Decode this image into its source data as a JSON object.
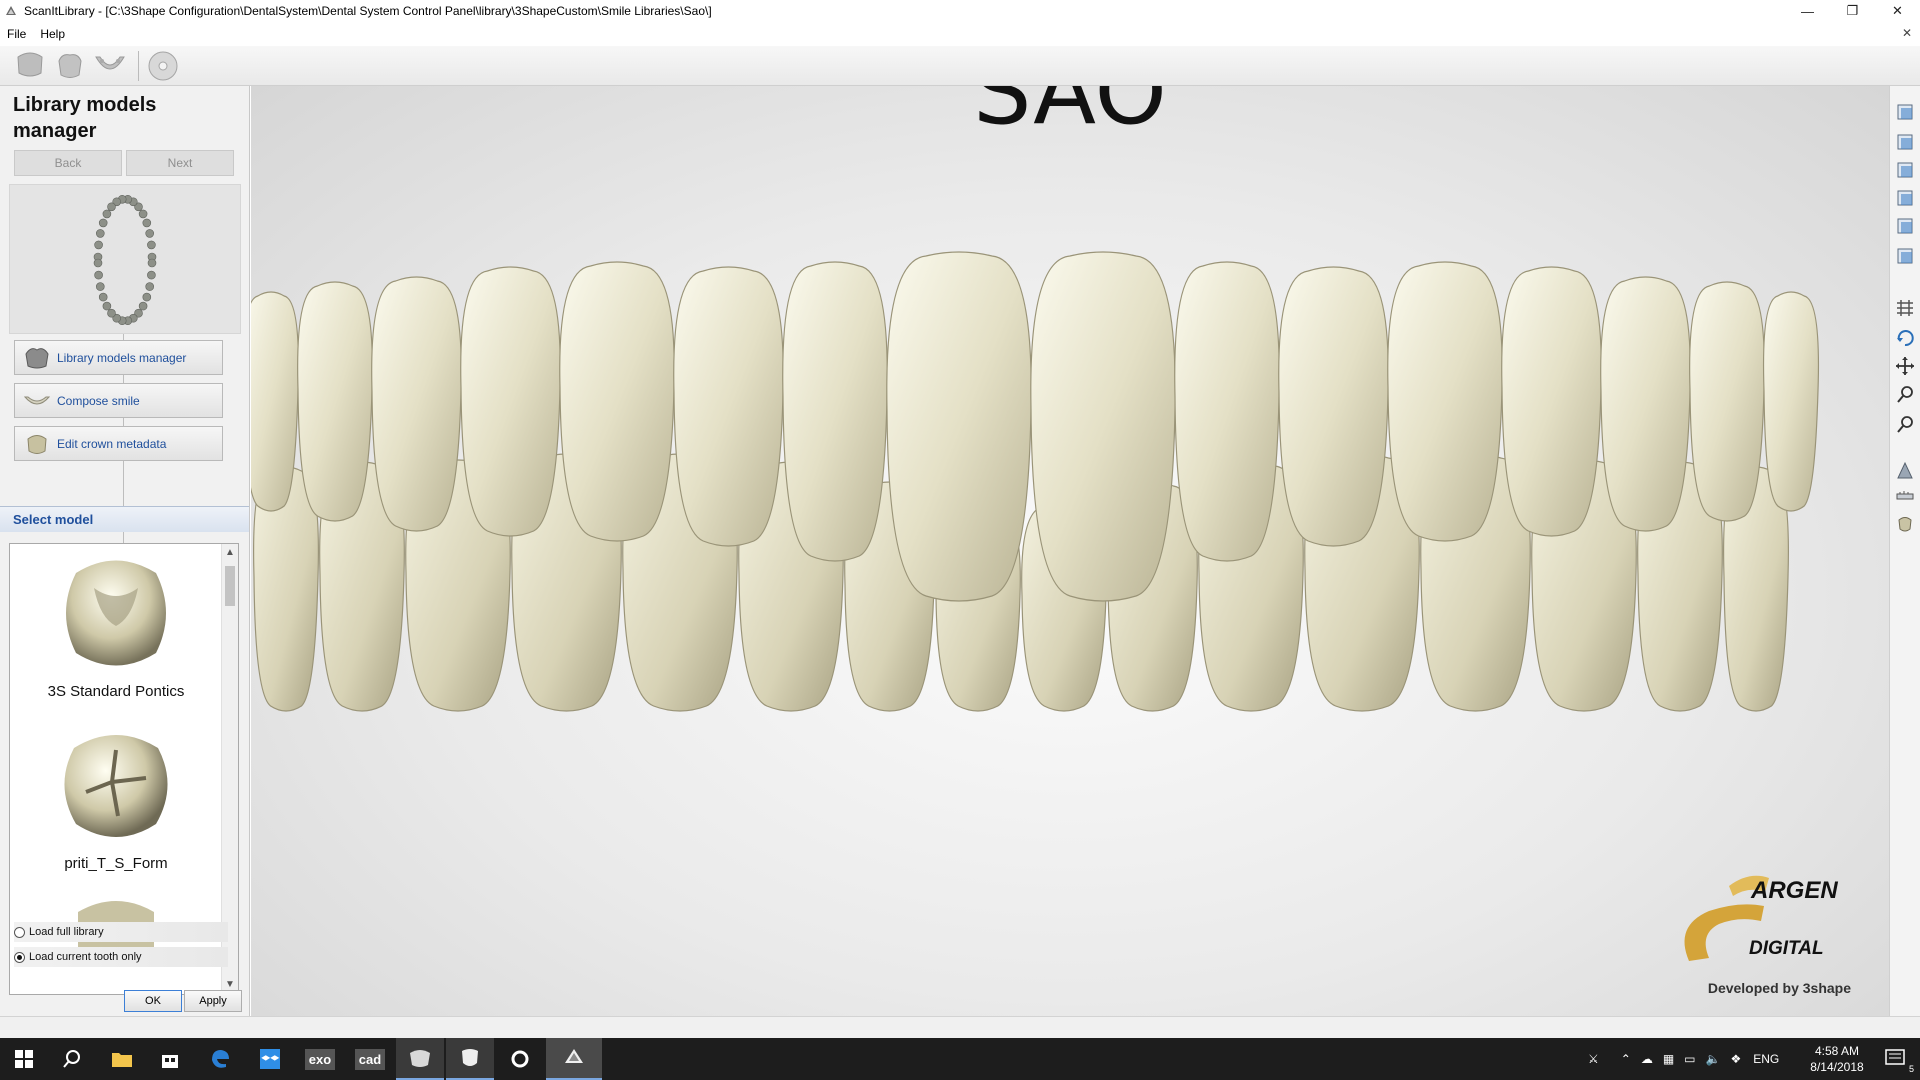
{
  "window": {
    "title": "ScanItLibrary - [C:\\3Shape Configuration\\DentalSystem\\Dental System Control Panel\\library\\3ShapeCustom\\Smile Libraries\\Sao\\]",
    "minimize_glyph": "—",
    "maximize_glyph": "❐",
    "close_glyph": "✕"
  },
  "menu": {
    "items": [
      "File",
      "Help"
    ],
    "close_glyph": "✕"
  },
  "toolbar": {
    "icons": [
      "crown-library-icon",
      "pontic-library-icon",
      "jaw-library-icon",
      "disc-icon"
    ]
  },
  "left_panel": {
    "title": "Library models manager",
    "back_label": "Back",
    "next_label": "Next",
    "steps": [
      {
        "label": "Library models manager",
        "icon": "tooth-icon"
      },
      {
        "label": "Compose smile",
        "icon": "smile-icon"
      },
      {
        "label": "Edit crown metadata",
        "icon": "crown-icon"
      }
    ],
    "select_model_header": "Select model",
    "models": [
      {
        "label": "3S Standard Pontics"
      },
      {
        "label": "priti_T_S_Form"
      }
    ],
    "radio_options": [
      {
        "label": "Load full library",
        "checked": false
      },
      {
        "label": "Load current tooth only",
        "checked": true
      }
    ],
    "ok_label": "OK",
    "apply_label": "Apply"
  },
  "viewport": {
    "model_title": "SAO",
    "brand_name": "ARGEN",
    "brand_sub": "DIGITAL",
    "developed_by": "Developed by 3shape",
    "tooth_color": "#e4e0c6",
    "brand_color": "#d4a43a"
  },
  "right_toolbar": {
    "icons": [
      "view-front-icon",
      "view-back-icon",
      "view-left-icon",
      "view-right-icon",
      "view-top-icon",
      "view-bottom-icon",
      "grid-icon",
      "rotate-icon",
      "pan-icon",
      "zoom-icon",
      "zoom-fit-icon",
      "scan-icon",
      "measure-icon",
      "tooth-view-icon"
    ]
  },
  "taskbar": {
    "pinned": [
      "windows-start-icon",
      "search-icon",
      "file-explorer-icon",
      "store-icon",
      "edge-icon",
      "dropbox-icon",
      "exo",
      "cad",
      "3shape-icon",
      "dental-icon",
      "cortana-icon",
      "scanit-icon"
    ],
    "exo_label": "exo",
    "cad_label": "cad",
    "language": "ENG",
    "time": "4:58 AM",
    "date": "8/14/2018",
    "notification_count": "5"
  }
}
